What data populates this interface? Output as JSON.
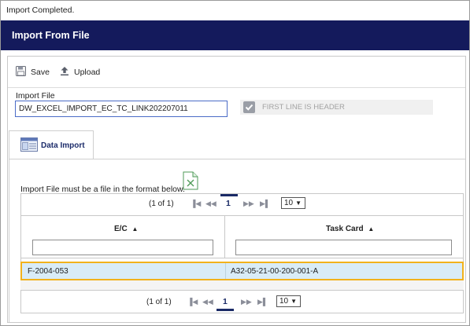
{
  "status_message": "Import Completed.",
  "window_title": "Import From File",
  "toolbar": {
    "save_label": "Save",
    "upload_label": "Upload"
  },
  "import_file": {
    "label": "Import File",
    "value": "DW_EXCEL_IMPORT_EC_TC_LINK202207011"
  },
  "header_checkbox": {
    "label": "FIRST LINE IS HEADER",
    "checked": true,
    "enabled": false
  },
  "tabs": [
    {
      "label": "Data Import",
      "icon": "data-import-icon"
    }
  ],
  "format_message": "Import File must be a file in the format below.",
  "format_icon": "excel-file-icon",
  "pager_top": {
    "info": "(1 of 1)",
    "current_page": "1",
    "page_size": "10"
  },
  "pager_bottom": {
    "info": "(1 of 1)",
    "current_page": "1",
    "page_size": "10"
  },
  "columns": [
    {
      "header": "E/C"
    },
    {
      "header": "Task Card"
    }
  ],
  "rows": [
    {
      "ec": "F-2004-053",
      "task_card": "A32-05-21-00-200-001-A"
    }
  ],
  "colors": {
    "title_bar": "#141a5c",
    "selected_row": "#d9ecf7",
    "selected_border": "#f2b21b"
  }
}
